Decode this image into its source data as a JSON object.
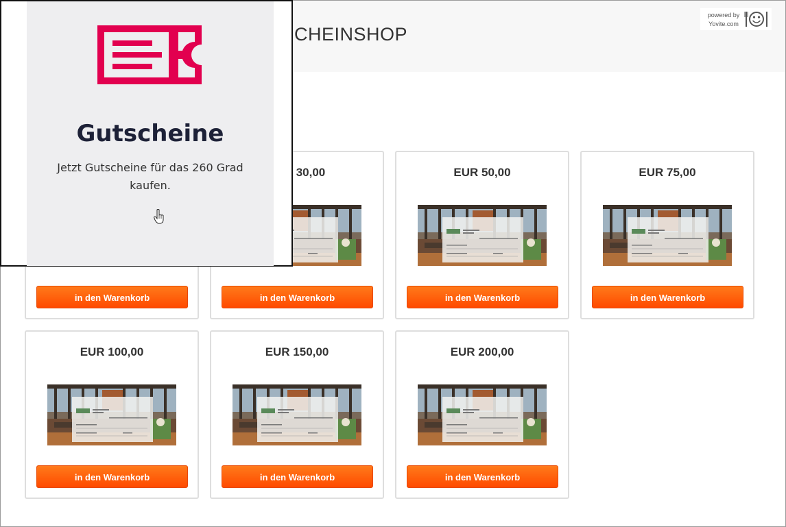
{
  "header": {
    "shop_title": "CHEINSHOP",
    "powered_line1": "powered by",
    "powered_line2": "Yovite.com"
  },
  "products": [
    {
      "price": "30,00",
      "button": "in den Warenkorb"
    },
    {
      "price": "EUR 50,00",
      "button": "in den Warenkorb"
    },
    {
      "price": "EUR 75,00",
      "button": "in den Warenkorb"
    },
    {
      "price": "EUR 100,00",
      "button": "in den Warenkorb"
    },
    {
      "price": "EUR 150,00",
      "button": "in den Warenkorb"
    },
    {
      "price": "EUR 200,00",
      "button": "in den Warenkorb"
    },
    {
      "button": "in den Warenkorb"
    }
  ],
  "overlay": {
    "title": "Gutscheine",
    "subtitle": "Jetzt Gutscheine für das 260 Grad kaufen."
  },
  "colors": {
    "button": "#ff5a00",
    "brand_red": "#e2004f",
    "title_dark": "#1d2137"
  }
}
